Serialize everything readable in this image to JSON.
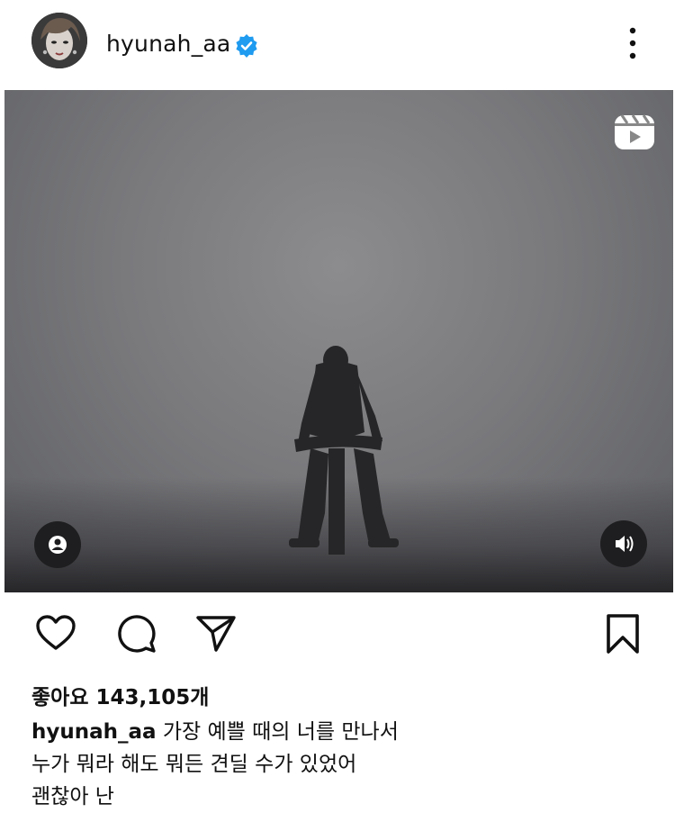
{
  "post": {
    "username": "hyunah_aa",
    "verified": true,
    "media_type": "reel",
    "likes_label": "좋아요 143,105개",
    "caption": {
      "username": "hyunah_aa",
      "line1": "가장 예쁠 때의 너를 만나서",
      "line2": "누가 뭐라 해도 뭐든 견딜 수가 있었어",
      "line3": "괜찮아 난"
    }
  },
  "icons": {
    "more": "more-vertical-icon",
    "verified": "verified-badge-icon",
    "reels": "reels-icon",
    "user_tag": "user-tag-icon",
    "audio": "volume-icon",
    "like": "heart-icon",
    "comment": "comment-icon",
    "share": "send-icon",
    "save": "bookmark-icon"
  },
  "colors": {
    "verified_blue": "#1f9bf0",
    "text": "#111111"
  }
}
